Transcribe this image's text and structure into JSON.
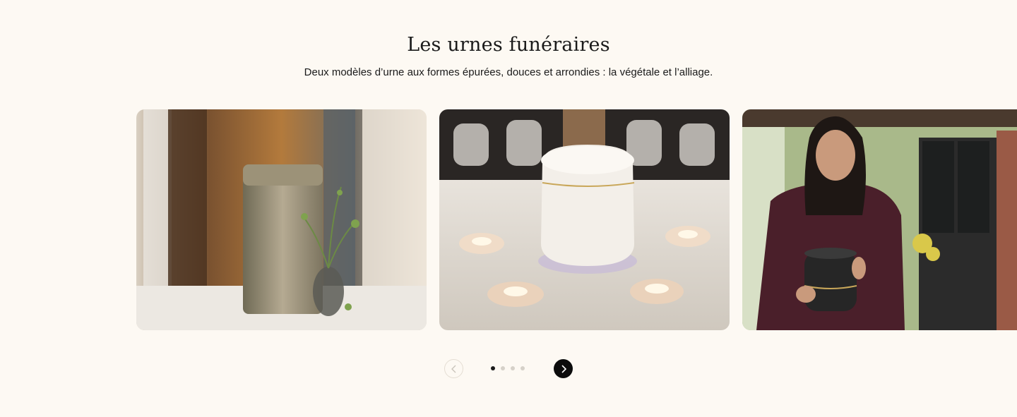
{
  "section": {
    "title": "Les urnes funéraires",
    "subtitle": "Deux modèles d’urne aux formes épurées, douces et arrondies : la végétale et l’alliage."
  },
  "carousel": {
    "slides": [
      {
        "image": "plant-fiber urn with small flower vase"
      },
      {
        "image": "white ceramic urn surrounded by tealight candles"
      },
      {
        "image": "woman holding a dark metal urn"
      }
    ],
    "active_dot": 1,
    "dot_count": 4
  },
  "icons": {
    "prev": "chevron-left-icon",
    "next": "chevron-right-icon"
  },
  "colors": {
    "background": "#fdf9f3",
    "text": "#1a1a1a",
    "next_button": "#0c0c0c",
    "dot_inactive": "#d6d1c9"
  }
}
